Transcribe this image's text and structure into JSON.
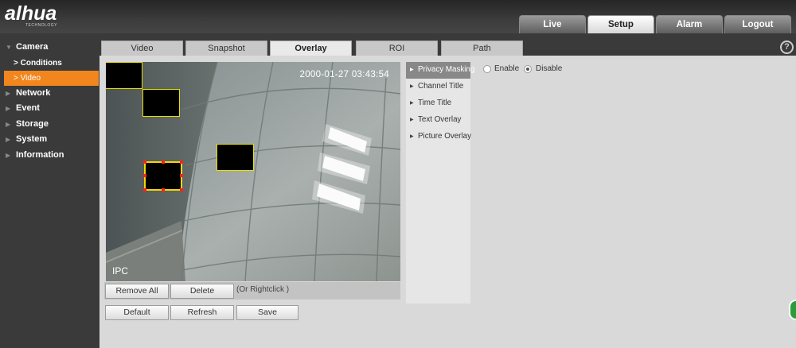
{
  "brand": {
    "logo_text": "alhua",
    "logo_sub": "TECHNOLOGY"
  },
  "top_nav": [
    "Live",
    "Setup",
    "Alarm",
    "Logout"
  ],
  "top_nav_active": "Setup",
  "sidebar": {
    "camera": "Camera",
    "conditions": "> Conditions",
    "video": "> Video",
    "network": "Network",
    "event": "Event",
    "storage": "Storage",
    "system": "System",
    "information": "Information"
  },
  "tabs": [
    "Video",
    "Snapshot",
    "Overlay",
    "ROI",
    "Path"
  ],
  "tab_active": "Overlay",
  "help": "?",
  "preview": {
    "timestamp": "2000-01-27 03:43:54",
    "label": "IPC"
  },
  "buttons": {
    "remove_all": "Remove All",
    "delete": "Delete",
    "hint": "(Or Rightclick )",
    "default": "Default",
    "refresh": "Refresh",
    "save": "Save"
  },
  "submenu": [
    "Privacy Masking",
    "Channel Title",
    "Time Title",
    "Text Overlay",
    "Picture Overlay"
  ],
  "submenu_active": "Privacy Masking",
  "privacy_masking": {
    "enable": "Enable",
    "disable": "Disable",
    "selected": "Disable"
  },
  "icons": {
    "help": "help-icon",
    "arrow": "triangle-right-icon",
    "collapse": "triangle-down-icon"
  },
  "colors": {
    "accent": "#f2861e",
    "mask_border": "#e6e000",
    "handle": "#ff2020"
  }
}
